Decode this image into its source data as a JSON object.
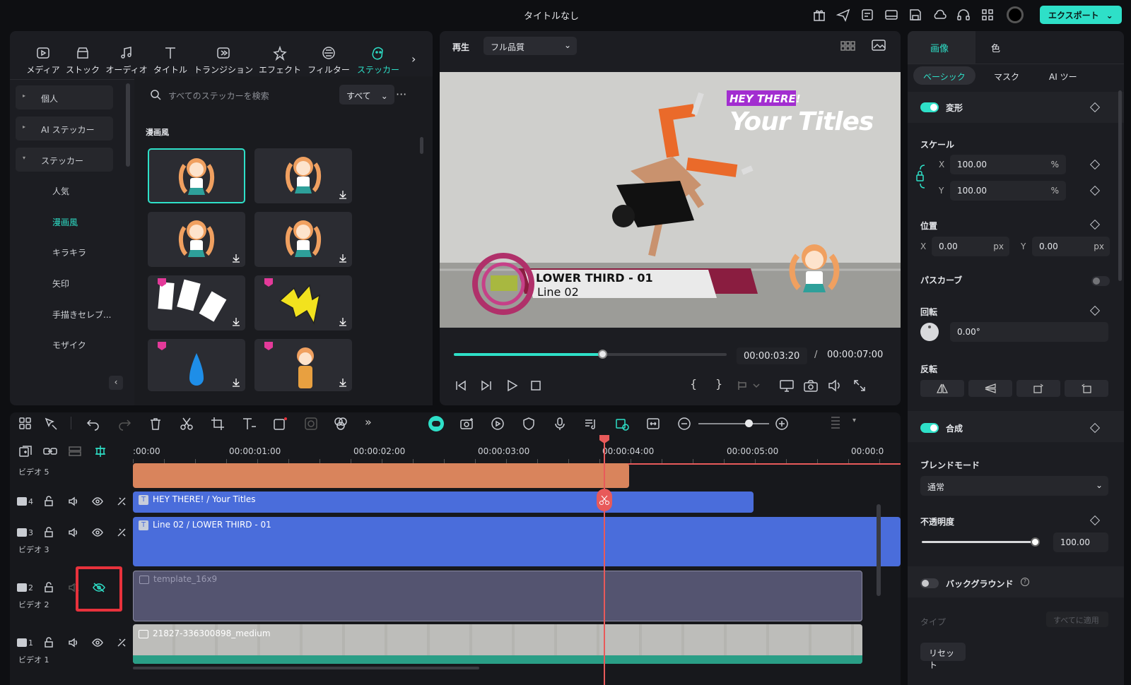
{
  "window": {
    "title": "タイトルなし",
    "export_label": "エクスポート"
  },
  "library": {
    "tabs": [
      {
        "label": "メディア",
        "icon": "media-icon"
      },
      {
        "label": "ストック",
        "icon": "stock-icon"
      },
      {
        "label": "オーディオ",
        "icon": "audio-icon"
      },
      {
        "label": "タイトル",
        "icon": "title-icon"
      },
      {
        "label": "トランジション",
        "icon": "transition-icon"
      },
      {
        "label": "エフェクト",
        "icon": "effect-icon"
      },
      {
        "label": "フィルター",
        "icon": "filter-icon"
      },
      {
        "label": "ステッカー",
        "icon": "sticker-icon"
      }
    ],
    "sidebar": {
      "personal": "個人",
      "ai_sticker": "AI ステッカー",
      "sticker": "ステッカー",
      "sub": [
        "人気",
        "漫画風",
        "キラキラ",
        "矢印",
        "手描きセレブ...",
        "モザイク"
      ]
    },
    "search_placeholder": "すべてのステッカーを検索",
    "filter": "すべて",
    "section": "漫画風"
  },
  "preview": {
    "play_label": "再生",
    "quality": "フル品質",
    "current_time": "00:00:03:20",
    "separator": "/",
    "total_time": "00:00:07:00",
    "progress": 0.55,
    "overlay": {
      "hey": "HEY THERE!",
      "your_titles": "Your Titles",
      "lower1": "LOWER THIRD - 01",
      "lower2": "Line 02"
    }
  },
  "props": {
    "tabs": {
      "image": "画像",
      "color": "色"
    },
    "subtabs": {
      "basic": "ベーシック",
      "mask": "マスク",
      "ai": "AI ツー"
    },
    "transform": "変形",
    "scale": "スケール",
    "x": "X",
    "y": "Y",
    "scale_x": "100.00",
    "scale_y": "100.00",
    "pct": "%",
    "position": "位置",
    "pos_x": "0.00",
    "pos_y": "0.00",
    "px": "px",
    "path_curve": "パスカーブ",
    "rotation": "回転",
    "rotation_val": "0.00°",
    "flip": "反転",
    "composite": "合成",
    "blend_mode": "ブレンドモード",
    "blend_value": "通常",
    "opacity": "不透明度",
    "opacity_val": "100.00",
    "background": "バックグラウンド",
    "type": "タイプ",
    "apply_all": "すべてに適用",
    "reset": "リセット"
  },
  "timeline": {
    "ruler": [
      ":00:00",
      "00:00:01:00",
      "00:00:02:00",
      "00:00:03:00",
      "00:00:04:00",
      "00:00:05:00",
      "00:00:0"
    ],
    "tracks": {
      "v5": "ビデオ 5",
      "t4": "4",
      "t3": "3",
      "v3": "ビデオ 3",
      "t2": "2",
      "v2": "ビデオ 2",
      "t1": "1",
      "v1": "ビデオ 1"
    },
    "clips": {
      "title_clip": "HEY THERE! / Your Titles",
      "lower_clip": "Line 02 / LOWER THIRD - 01",
      "template": "template_16x9",
      "video": "21827-336300898_medium"
    }
  },
  "colors": {
    "accent": "#2ee0c8",
    "title_clip": "#4a6ddb",
    "orange_clip": "#d9845c",
    "highlight": "#e8323c",
    "playhead": "#e85a5a"
  }
}
